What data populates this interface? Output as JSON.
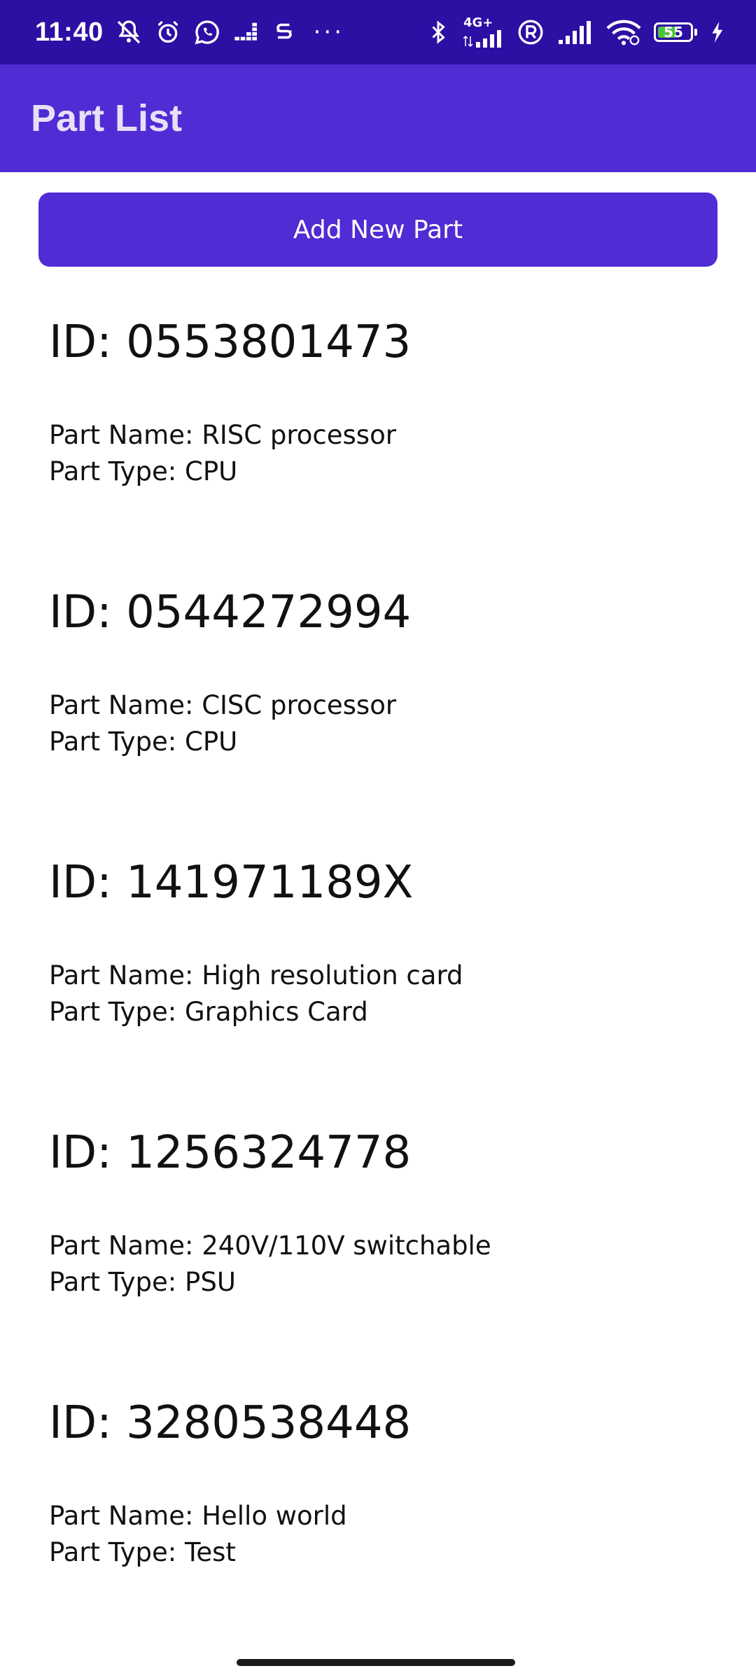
{
  "status_bar": {
    "time": "11:40",
    "left_icons": [
      "muted-bell-icon",
      "alarm-icon",
      "whatsapp-icon",
      "deezer-icon",
      "s-app-icon"
    ],
    "overflow": "···",
    "network_label": "4G+",
    "battery_level": "55",
    "right_icons": [
      "bluetooth-icon",
      "signal-4g-icon",
      "roaming-icon",
      "signal-icon",
      "wifi-icon",
      "battery-icon",
      "charging-icon"
    ]
  },
  "app_bar": {
    "title": "Part List"
  },
  "actions": {
    "add_part_label": "Add New Part"
  },
  "parts": [
    {
      "id_label": "ID: 0553801473",
      "name_label": "Part Name: RISC processor",
      "type_label": "Part Type: CPU"
    },
    {
      "id_label": "ID: 0544272994",
      "name_label": "Part Name: CISC processor",
      "type_label": "Part Type: CPU"
    },
    {
      "id_label": "ID: 141971189X",
      "name_label": "Part Name: High resolution card",
      "type_label": "Part Type: Graphics Card"
    },
    {
      "id_label": "ID: 1256324778",
      "name_label": "Part Name: 240V/110V switchable",
      "type_label": "Part Type: PSU"
    },
    {
      "id_label": "ID: 3280538448",
      "name_label": "Part Name: Hello world",
      "type_label": "Part Type: Test"
    }
  ],
  "colors": {
    "status_bar": "#2c0fa3",
    "primary": "#512bd4",
    "app_title": "#e6e0f7",
    "text": "#111111",
    "battery_fill": "#4cc43c"
  }
}
